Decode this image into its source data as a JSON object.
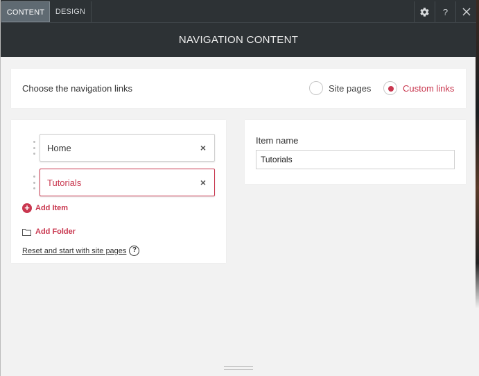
{
  "tabs": [
    {
      "label": "CONTENT",
      "active": true
    },
    {
      "label": "DESIGN",
      "active": false
    }
  ],
  "toolbar": {
    "settings_icon": "gear-icon",
    "help_label": "?",
    "close_icon": "close-icon"
  },
  "header": {
    "title": "NAVIGATION CONTENT"
  },
  "source": {
    "label": "Choose the navigation links",
    "options": [
      {
        "label": "Site pages",
        "selected": false
      },
      {
        "label": "Custom links",
        "selected": true
      }
    ]
  },
  "links": {
    "items": [
      {
        "label": "Home",
        "selected": false
      },
      {
        "label": "Tutorials",
        "selected": true
      }
    ],
    "remove_glyph": "×",
    "add_item_label": "Add Item",
    "add_folder_label": "Add Folder",
    "reset_label": "Reset and start with site pages",
    "reset_help_glyph": "?"
  },
  "editor": {
    "item_name_label": "Item name",
    "item_name_value": "Tutorials"
  },
  "colors": {
    "accent": "#c9374f",
    "dark_bar": "#2d3235",
    "panel_bg": "#f2f2f2"
  }
}
